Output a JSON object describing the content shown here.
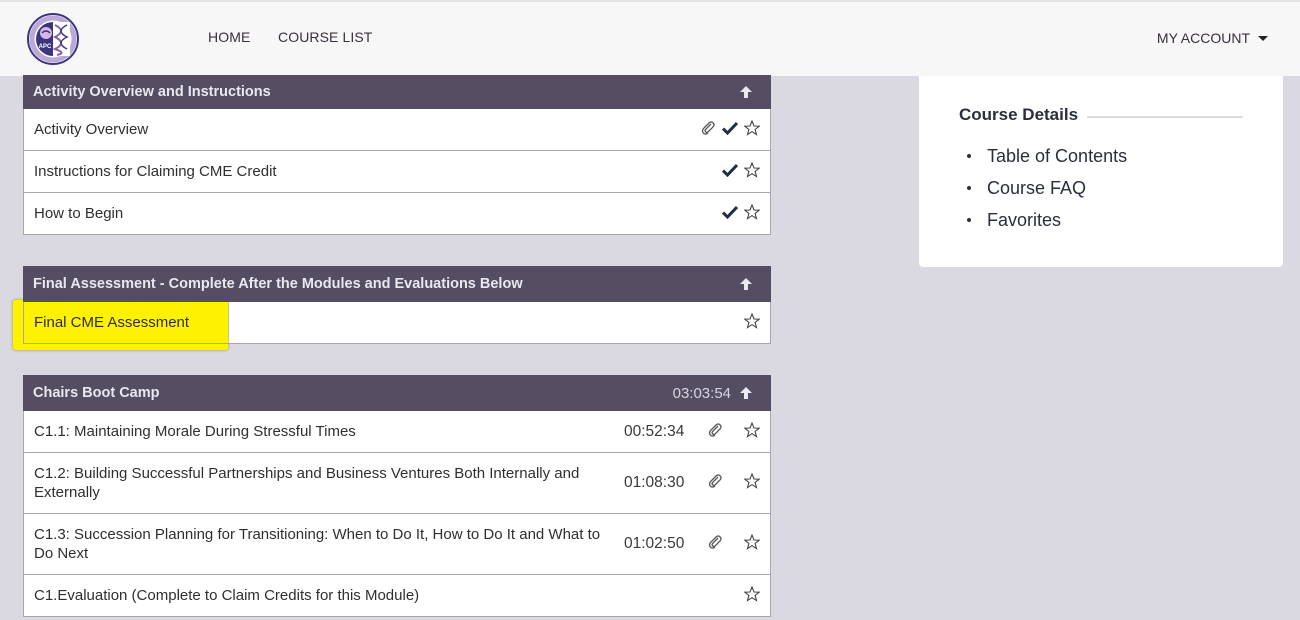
{
  "nav": {
    "logo_alt": "APC",
    "links": [
      {
        "label": "HOME"
      },
      {
        "label": "COURSE LIST"
      }
    ],
    "account_label": "MY ACCOUNT"
  },
  "sections": [
    {
      "title": "Activity Overview and Instructions",
      "total_time": "",
      "items": [
        {
          "label": "Activity Overview",
          "duration": "",
          "attachment": true,
          "completed": true,
          "favorite": false
        },
        {
          "label": "Instructions for Claiming CME Credit",
          "duration": "",
          "attachment": false,
          "completed": true,
          "favorite": false
        },
        {
          "label": "How to Begin",
          "duration": "",
          "attachment": false,
          "completed": true,
          "favorite": false
        }
      ]
    },
    {
      "title": "Final Assessment - Complete After the Modules and Evaluations Below",
      "total_time": "",
      "items": [
        {
          "label": "Final CME Assessment",
          "duration": "",
          "attachment": false,
          "completed": false,
          "favorite": false,
          "highlighted": true
        }
      ]
    },
    {
      "title": "Chairs Boot Camp",
      "total_time": "03:03:54",
      "items": [
        {
          "label": "C1.1: Maintaining Morale During Stressful Times",
          "duration": "00:52:34",
          "attachment": true,
          "completed": false,
          "favorite": false
        },
        {
          "label": "C1.2: Building Successful Partnerships and Business Ventures Both Internally and Externally",
          "duration": "01:08:30",
          "attachment": true,
          "completed": false,
          "favorite": false
        },
        {
          "label": "C1.3: Succession Planning for Transitioning: When to Do It, How to Do It and What to Do Next",
          "duration": "01:02:50",
          "attachment": true,
          "completed": false,
          "favorite": false
        },
        {
          "label": "C1.Evaluation (Complete to Claim Credits for this Module)",
          "duration": "",
          "attachment": false,
          "completed": false,
          "favorite": false
        }
      ]
    }
  ],
  "course_details": {
    "title": "Course Details",
    "links": [
      {
        "label": "Table of Contents"
      },
      {
        "label": "Course FAQ"
      },
      {
        "label": "Favorites"
      }
    ]
  },
  "colors": {
    "section_header_bg": "#554e63",
    "page_bg": "#dad8e1",
    "highlight": "#fff200",
    "check": "#1f2d44"
  }
}
